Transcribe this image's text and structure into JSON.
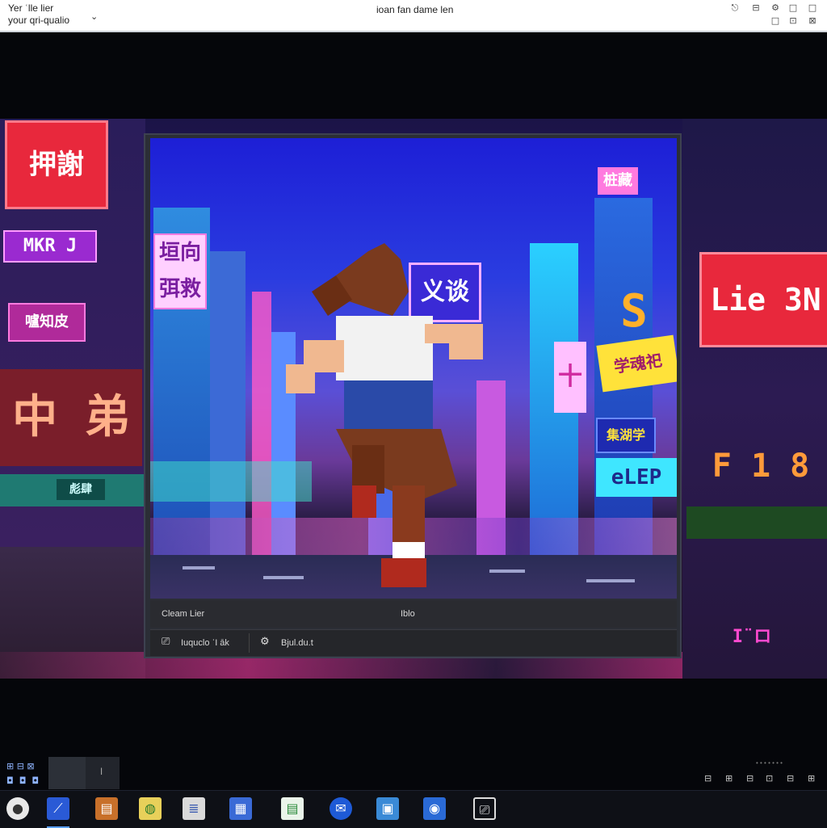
{
  "window": {
    "title_left_line1": "Yer ʿlle lier",
    "title_left_line2": "your qri-qualio",
    "title_center": "ioan fan dame len",
    "chevron": "⌄"
  },
  "scene": {
    "sign_top_left": "押謝",
    "sign_mkr": "MKR J",
    "sign_small_left": "嚧知皮",
    "sign_big_left": "中 弟",
    "sign_left_store": "彪肆",
    "sign_right_big": "Lie 3N",
    "sign_right_low": "F 1 8",
    "sign_right_small": "I¨ロ"
  },
  "game": {
    "sign_blue_left": "垣向 弭救",
    "sign_center": "义谈",
    "sign_top_right": "桩藏",
    "sign_s": "S",
    "sign_yellow": "学魂祀",
    "sign_blue_right": "集湖学",
    "sign_cyan": "eLEP",
    "sign_pink_small": "十",
    "bar_left_label": "Cleam Lier",
    "bar_center_label": "Iblo",
    "btn1_label": "Iuquclo ʿI āk",
    "btn2_label": "Bjul.du.t"
  },
  "colors": {
    "accent": "#5aa0ff",
    "neon_pink": "#ff3aa0",
    "neon_red": "#e8283c",
    "neon_cyan": "#3fe6ff",
    "neon_yellow": "#ffe23a"
  }
}
